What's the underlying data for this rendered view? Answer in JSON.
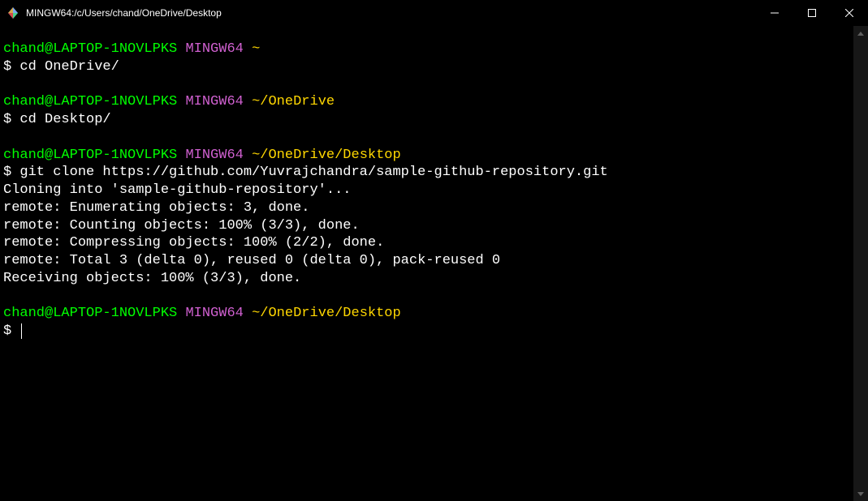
{
  "window": {
    "title": "MINGW64:/c/Users/chand/OneDrive/Desktop"
  },
  "prompt": {
    "user_host": "chand@LAPTOP-1NOVLPKS",
    "shell": "MINGW64",
    "dollar": "$"
  },
  "blocks": [
    {
      "path": "~",
      "command": "cd OneDrive/",
      "output": []
    },
    {
      "path": "~/OneDrive",
      "command": "cd Desktop/",
      "output": []
    },
    {
      "path": "~/OneDrive/Desktop",
      "command": "git clone https://github.com/Yuvrajchandra/sample-github-repository.git",
      "output": [
        "Cloning into 'sample-github-repository'...",
        "remote: Enumerating objects: 3, done.",
        "remote: Counting objects: 100% (3/3), done.",
        "remote: Compressing objects: 100% (2/2), done.",
        "remote: Total 3 (delta 0), reused 0 (delta 0), pack-reused 0",
        "Receiving objects: 100% (3/3), done."
      ]
    },
    {
      "path": "~/OneDrive/Desktop",
      "command": "",
      "output": []
    }
  ]
}
